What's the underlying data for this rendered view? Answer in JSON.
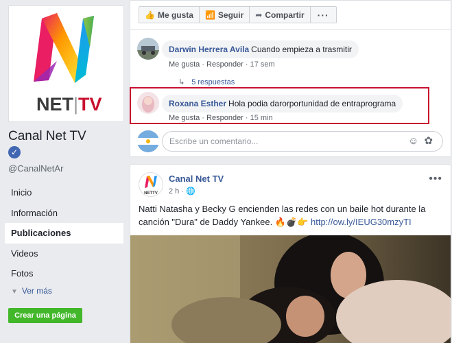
{
  "page": {
    "name": "Canal Net TV",
    "handle": "@CanalNetAr",
    "logo_text": "NET|TV",
    "verified_icon": "check-icon"
  },
  "nav": {
    "items": [
      {
        "label": "Inicio",
        "active": false
      },
      {
        "label": "Información",
        "active": false
      },
      {
        "label": "Publicaciones",
        "active": true
      },
      {
        "label": "Videos",
        "active": false
      },
      {
        "label": "Fotos",
        "active": false
      }
    ],
    "see_more": "Ver más",
    "create_page": "Crear una página"
  },
  "action_bar": {
    "like": "Me gusta",
    "follow": "Seguir",
    "share": "Compartir",
    "more": "···"
  },
  "comments": [
    {
      "author": "Darwin Herrera Avila",
      "text": "Cuando empieza a trasmitir",
      "like": "Me gusta",
      "reply": "Responder",
      "time": "17 sem",
      "replies": "5 respuestas"
    },
    {
      "author": "Roxana Esther",
      "text": "Hola podia darorportunidad de entraprograma",
      "like": "Me gusta",
      "reply": "Responder",
      "time": "15 min"
    }
  ],
  "composer": {
    "placeholder": "Escribe un comentario..."
  },
  "post": {
    "author": "Canal Net TV",
    "time": "2 h ·",
    "text": "Natti Natasha y Becky G encienden las redes con un baile hot durante la canción \"Dura\" de Daddy Yankee. 🔥💣👉",
    "link": "http://ow.ly/IEUG30mzyTI"
  },
  "colors": {
    "link": "#385898",
    "accent_green": "#42b72a",
    "highlight": "#c8102e",
    "background": "#e9ebee"
  }
}
